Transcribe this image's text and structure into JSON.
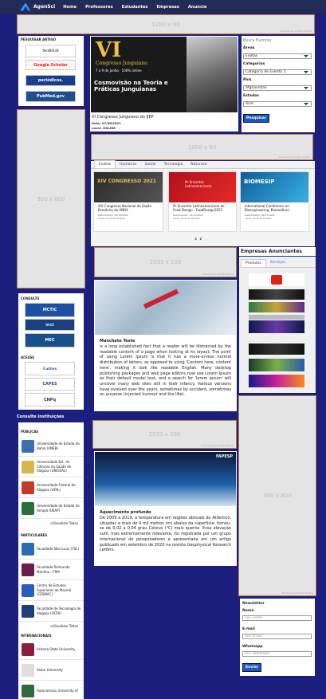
{
  "nav": {
    "brand": "AgenSci",
    "links": [
      "Home",
      "Professores",
      "Estudantes",
      "Empresas",
      "Anuncie"
    ]
  },
  "ads": {
    "top_banner": "1200 x 90",
    "mid_banner": "1000 x 90",
    "left_tall": "300 x 800",
    "center_1": "1033 x 200",
    "center_2": "1033 x 200",
    "right_tall": "300 x 800",
    "powered_by": "Powered by #### ####"
  },
  "left": {
    "search_title": "PESQUISAR ARTIGO",
    "search_logos": [
      "SciELO",
      "Google Scholar",
      "periódicos.",
      "PubMed.gov"
    ],
    "consult_title": "CONSULTS",
    "consult_logos": [
      "MCTIC",
      "inct",
      "MEC"
    ],
    "access_title": "ACESSE",
    "access_logos": [
      "Lattes",
      "CAPES",
      "CNPq"
    ],
    "institutions_title": "Consulte Instituições",
    "publicas_title": "PÚBLICAS",
    "publicas": [
      "Universidade do Estado da Bahia (UNEB)",
      "Universidade Est. de Ciências da Saúde de Alagoas (UNCISAL)",
      "Universidade Federal de Alagoas (UFAL)",
      "Universidade do Estado do Amapá (UEAP)"
    ],
    "particulares_title": "PARTICULARES",
    "particulares": [
      "Faculdade São Lucas (FSL)",
      "Faculdade Raimundo Marinho - FRM",
      "Centro de Estudos Superiores de Maceió (CESMAC)",
      "Faculdade de Tecnologia de Alagoas (FATIA)"
    ],
    "internacionais_title": "INTERNACIONAIS",
    "internacionais": [
      "Arizona State University",
      "Aston University",
      "Autonomous University of"
    ],
    "view_all": "Visualizar Todos"
  },
  "feature": {
    "poster_title_big": "VI",
    "poster_title_sub": "Congresso Junguiano",
    "poster_date": "7 a 9 de Junho · 100% online",
    "poster_headline": "Cosmovisão na Teoria e Práticas Junguianas",
    "event_name": "VI Congresso Junguiano do IJEP",
    "event_date": "Data: 07/06/2021",
    "event_place": "Local: ONLINE"
  },
  "filter": {
    "search_label": "Busca Eventos",
    "areas_label": "Áreas",
    "areas_value": "Exatas",
    "categorias_label": "Categorias",
    "categorias_value": "Categoria de Evento 1",
    "pais_label": "País",
    "pais_value": "Afghanistan",
    "estados_label": "Estados",
    "estados_value": "Acre",
    "button": "Pesquisar"
  },
  "tabs": [
    "Exatas",
    "Humanas",
    "Saúde",
    "Tecnologia",
    "Natureza"
  ],
  "events": [
    {
      "title": "XIV Congresso Nacional da Seção Brasileira da ANDA",
      "date": "Data Evento: 16/10/2021",
      "place": "Local: Local do Evento",
      "banner": "XIV CONGRESSO 2021"
    },
    {
      "title": "9º Encontro Latinoamericano de Food Design - FoodDesign2021",
      "date": "Data Evento: 11/11/2021",
      "place": "Local: Local do Evento",
      "banner": "9º Encontro Latinoamericano"
    },
    {
      "title": "International Conference on Bioengineering, Biomedical...",
      "date": "Data Evento: 10/07/2021",
      "place": "Local: Local do Evento",
      "banner": "BIOMESIP"
    }
  ],
  "carousel_arrows": "‹ ›",
  "articles": [
    {
      "heading": "Manchete Teste",
      "body": "is a long established fact that a reader will be distracted by the readable content of a page when looking at its layout. The point of using Lorem Ipsum is that it has a more-or-less normal distribution of letters, as opposed to using 'Content here, content here', making it look like readable English. Many desktop publishing packages and web page editors now use Lorem Ipsum as their default model text, and a search for 'lorem ipsum' will uncover many web sites still in their infancy. Various versions have evolved over the years, sometimes by accident, sometimes on purpose (injected humour and the like)."
    },
    {
      "heading": "Aquecimento profundo",
      "body": "De 2009 a 2019, a temperatura em regiões abissais do Atlântico, situadas a mais de 4 mil metros (m) abaixo da superfície, tornou-se de 0,02 a 0,04 grau Celsius (°C) mais quente. Essa elevação sutil, mas extremamente relevante, foi registrada por um grupo internacional de pesquisadores e apresentada em um artigo publicado em setembro de 2020 na revista",
      "journal": "Geophysical Research Letters.",
      "watermark": "FAPESP"
    }
  ],
  "advertisers": {
    "title": "Empresas Anunciantes",
    "tabs": [
      "Produtos",
      "Serviços"
    ]
  },
  "newsletter": {
    "title": "Newsletter",
    "name_label": "Nome",
    "name_placeholder": "seu nome",
    "email_label": "E-mail",
    "email_placeholder": "seu email",
    "whatsapp_label": "Whatsapp",
    "whatsapp_placeholder": "seu whatsapp",
    "button": "Enviar"
  },
  "colors": {
    "background": "#1d1f7e",
    "nav": "#222a55",
    "ad_border": "#c08040",
    "button": "#1a5bb8"
  }
}
